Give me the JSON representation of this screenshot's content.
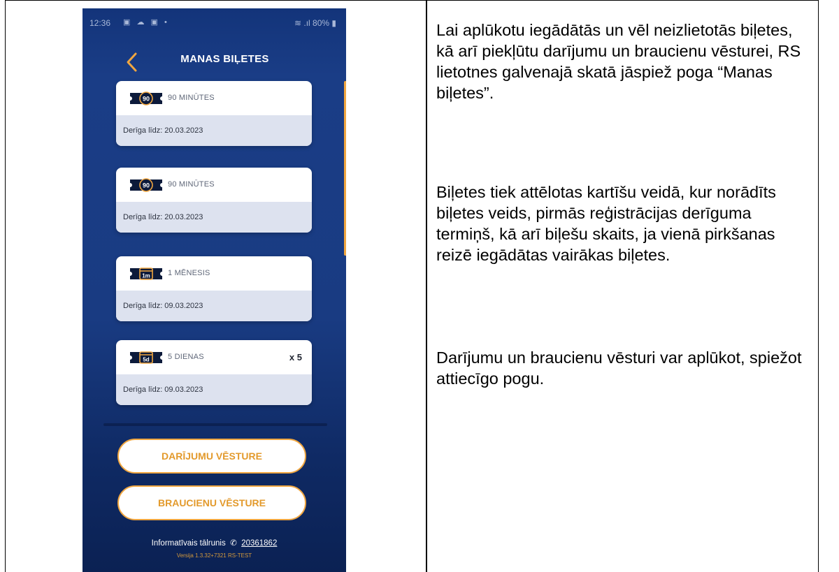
{
  "status_bar": {
    "time": "12:36",
    "notification_icons": "▣ ☁ ▣ •",
    "battery": "80%"
  },
  "header": {
    "title": "MANAS BIĻETES"
  },
  "tickets": [
    {
      "icon_label": "90",
      "type": "90 MINŪTES",
      "count": "",
      "valid": "Derīga līdz: 20.03.2023"
    },
    {
      "icon_label": "90",
      "type": "90 MINŪTES",
      "count": "",
      "valid": "Derīga līdz: 20.03.2023"
    },
    {
      "icon_label": "1m",
      "type": "1 MĒNESIS",
      "count": "",
      "valid": "Derīga līdz: 09.03.2023"
    },
    {
      "icon_label": "5d",
      "type": "5 DIENAS",
      "count": "x 5",
      "valid": "Derīga līdz: 09.03.2023"
    }
  ],
  "buttons": {
    "transactions": "DARĪJUMU VĒSTURE",
    "trips": "BRAUCIENU VĒSTURE"
  },
  "footer": {
    "info_label": "Informatīvais tālrunis",
    "phone": "20361862",
    "version": "Versija 1.3.32+7321 RS-TEST"
  },
  "colors": {
    "background": "#193b82",
    "accent": "#f0a640",
    "icon_dark": "#0c1a3a"
  },
  "description": {
    "paragraph1": "Lai aplūkotu iegādātās un vēl neizlietotās biļetes, kā arī piekļūtu darījumu un braucienu vēsturei, RS lietotnes galvenajā skatā jāspiež poga “Manas biļetes”.",
    "paragraph2": "Biļetes tiek attēlotas kartīšu veidā, kur norādīts biļetes veids, pirmās reģistrācijas derīguma termiņš, kā arī biļešu skaits, ja vienā pirkšanas reizē iegādātas vairākas biļetes.",
    "paragraph3": "Darījumu un braucienu vēsturi var aplūkot, spiežot attiecīgo pogu."
  }
}
